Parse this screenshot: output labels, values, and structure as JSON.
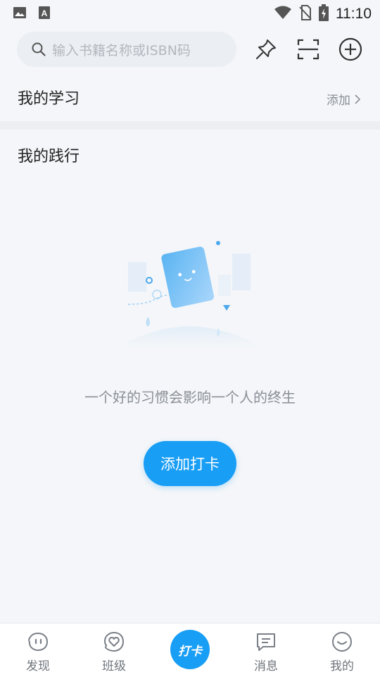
{
  "status_bar": {
    "time": "11:10",
    "icons": [
      "image-icon",
      "a-icon",
      "wifi-icon",
      "no-sim-icon",
      "battery-charging-icon"
    ]
  },
  "search": {
    "placeholder": "输入书籍名称或ISBN码"
  },
  "top_actions": [
    "pin-icon",
    "scan-icon",
    "add-circle-icon"
  ],
  "study": {
    "title": "我的学习",
    "add_label": "添加"
  },
  "practice": {
    "title": "我的践行"
  },
  "empty_state": {
    "message": "一个好的习惯会影响一个人的终生",
    "button_label": "添加打卡"
  },
  "tabbar": {
    "tabs": [
      {
        "label": "发现",
        "icon": "discover-face-icon"
      },
      {
        "label": "班级",
        "icon": "heart-icon"
      },
      {
        "label": "打卡",
        "icon": "checkin-icon"
      },
      {
        "label": "消息",
        "icon": "message-icon"
      },
      {
        "label": "我的",
        "icon": "smile-face-icon"
      }
    ]
  },
  "colors": {
    "accent": "#199ef5",
    "background": "#f4f6f9"
  }
}
